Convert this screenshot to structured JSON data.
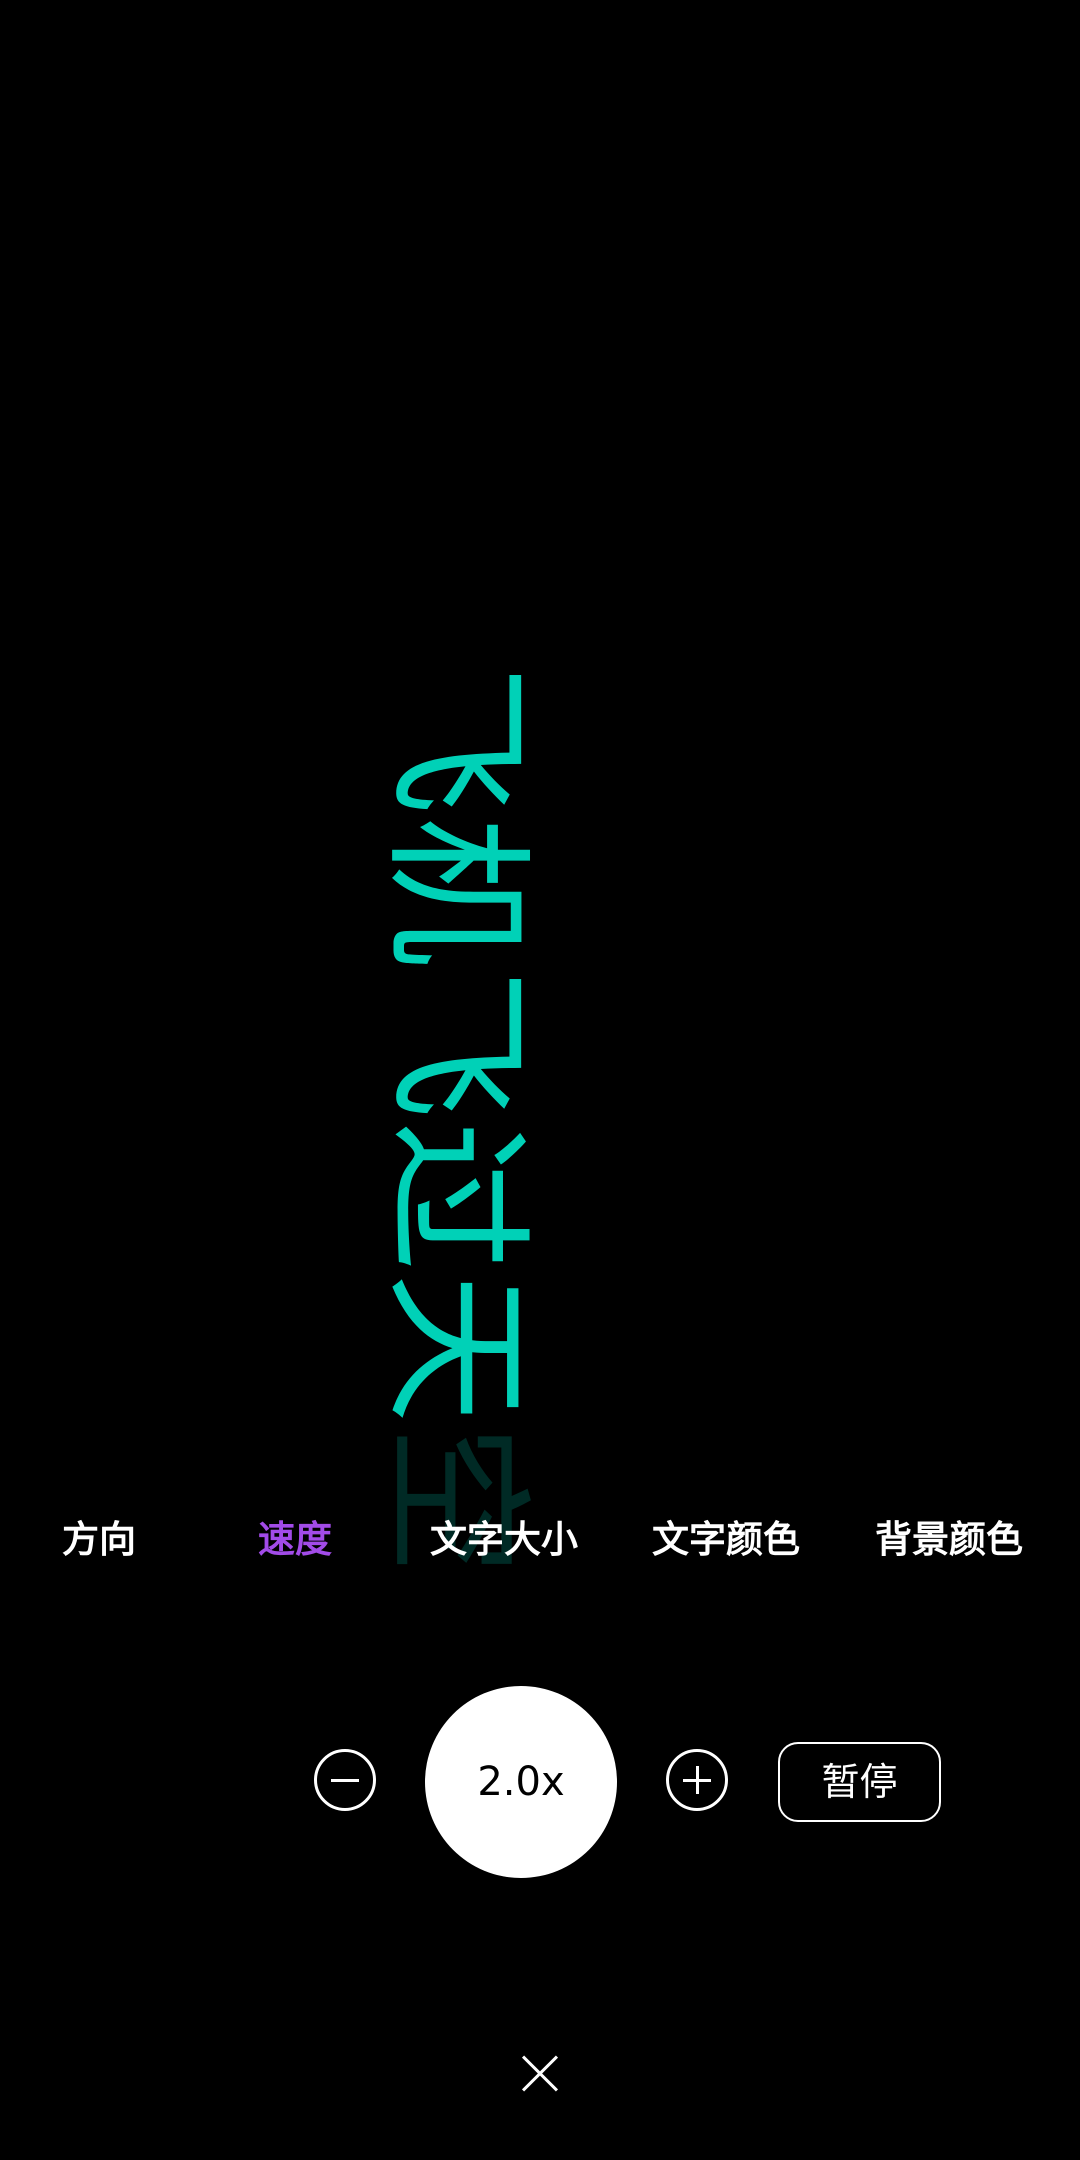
{
  "marquee": {
    "text": "飞机飞过天空",
    "text_color": "#00D1B7",
    "background_color": "#000000",
    "direction": "vertical"
  },
  "options": [
    {
      "label": "方向",
      "selected": false
    },
    {
      "label": "速度",
      "selected": true
    },
    {
      "label": "文字大小",
      "selected": false
    },
    {
      "label": "文字颜色",
      "selected": false
    },
    {
      "label": "背景颜色",
      "selected": false
    }
  ],
  "selected_color": "#A24BE8",
  "controls": {
    "speed_value": "2.0x",
    "decrease_icon": "minus-circle-icon",
    "increase_icon": "plus-circle-icon",
    "pause_label": "暂停"
  },
  "close_icon": "close-x-icon"
}
